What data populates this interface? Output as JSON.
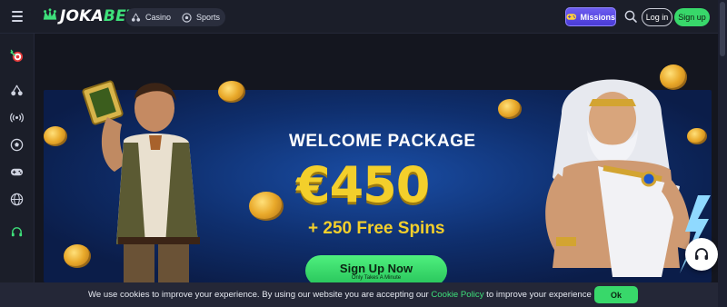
{
  "header": {
    "logo_prefix": "JOKA",
    "logo_suffix": "BET",
    "nav": [
      {
        "label": "Casino",
        "icon": "cherries-icon"
      },
      {
        "label": "Sports",
        "icon": "soccer-ball-icon"
      }
    ],
    "missions_label": "Missions",
    "login_label": "Log in",
    "signup_label": "Sign up"
  },
  "sidebar": {
    "items": [
      {
        "name": "wheel-target-icon"
      },
      {
        "name": "cherries-icon"
      },
      {
        "name": "live-broadcast-icon"
      },
      {
        "name": "soccer-ball-icon"
      },
      {
        "name": "gamepad-icon"
      },
      {
        "name": "globe-icon"
      },
      {
        "name": "headset-icon"
      }
    ]
  },
  "banner": {
    "title": "WELCOME PACKAGE",
    "amount": "€450",
    "spins": "+ 250 Free Spins",
    "cta_label": "Sign Up Now",
    "cta_sub": "Only Takes A Minute"
  },
  "cookie": {
    "text_before": "We use cookies to improve your experience. By using our website you are accepting our ",
    "link": "Cookie Policy",
    "text_after": " to improve your experience",
    "ok_label": "Ok"
  },
  "colors": {
    "accent_green": "#38d86a",
    "gold": "#f3cf2b",
    "missions_purple": "#5a4be6",
    "bg": "#14161f"
  }
}
